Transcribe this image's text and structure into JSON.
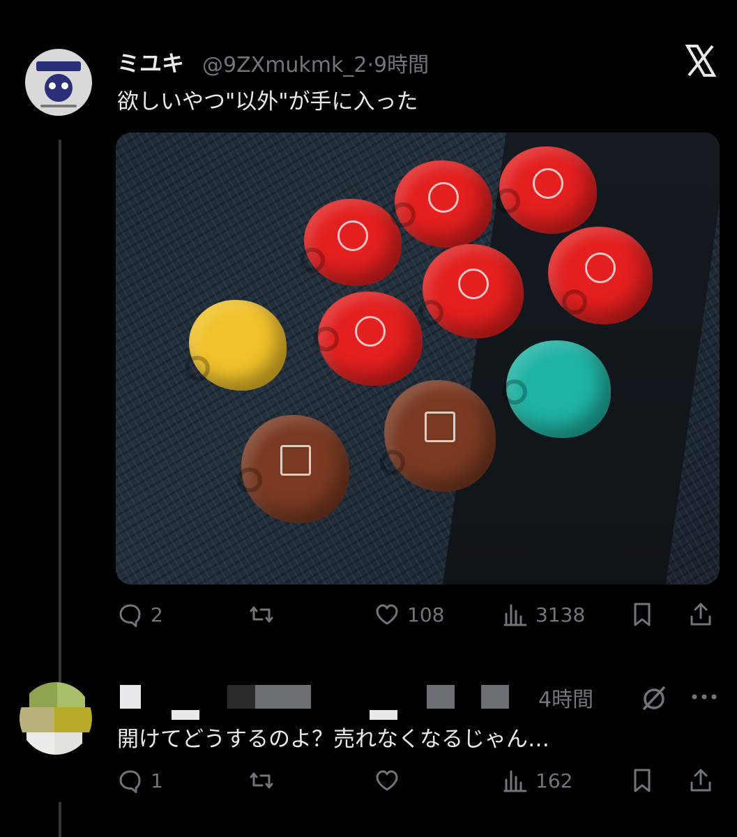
{
  "tweet": {
    "author_name": "ミユキ",
    "handle_time": "@9ZXmukmk_2·9時間",
    "text": "欲しいやつ\"以外\"が手に入った",
    "media_alt": "photo of red, brown, yellow and teal capsule toys on a car seat",
    "stats": {
      "replies": "2",
      "retweets": "",
      "likes": "108",
      "views": "3138"
    }
  },
  "reply": {
    "time": "4時間",
    "text": "開けてどうするのよ？売れなくなるじゃん…",
    "stats": {
      "replies": "1",
      "retweets": "",
      "likes": "",
      "views": "162"
    }
  },
  "icons": {
    "app_logo": "x-logo-icon",
    "reply": "reply-icon",
    "retweet": "retweet-icon",
    "like": "heart-icon",
    "views": "views-icon",
    "bookmark": "bookmark-icon",
    "share": "share-icon",
    "grok": "grok-icon",
    "more": "more-icon"
  },
  "colors": {
    "background": "#000000",
    "text": "#e7e9ea",
    "muted": "#71767b",
    "thread": "#333639"
  }
}
